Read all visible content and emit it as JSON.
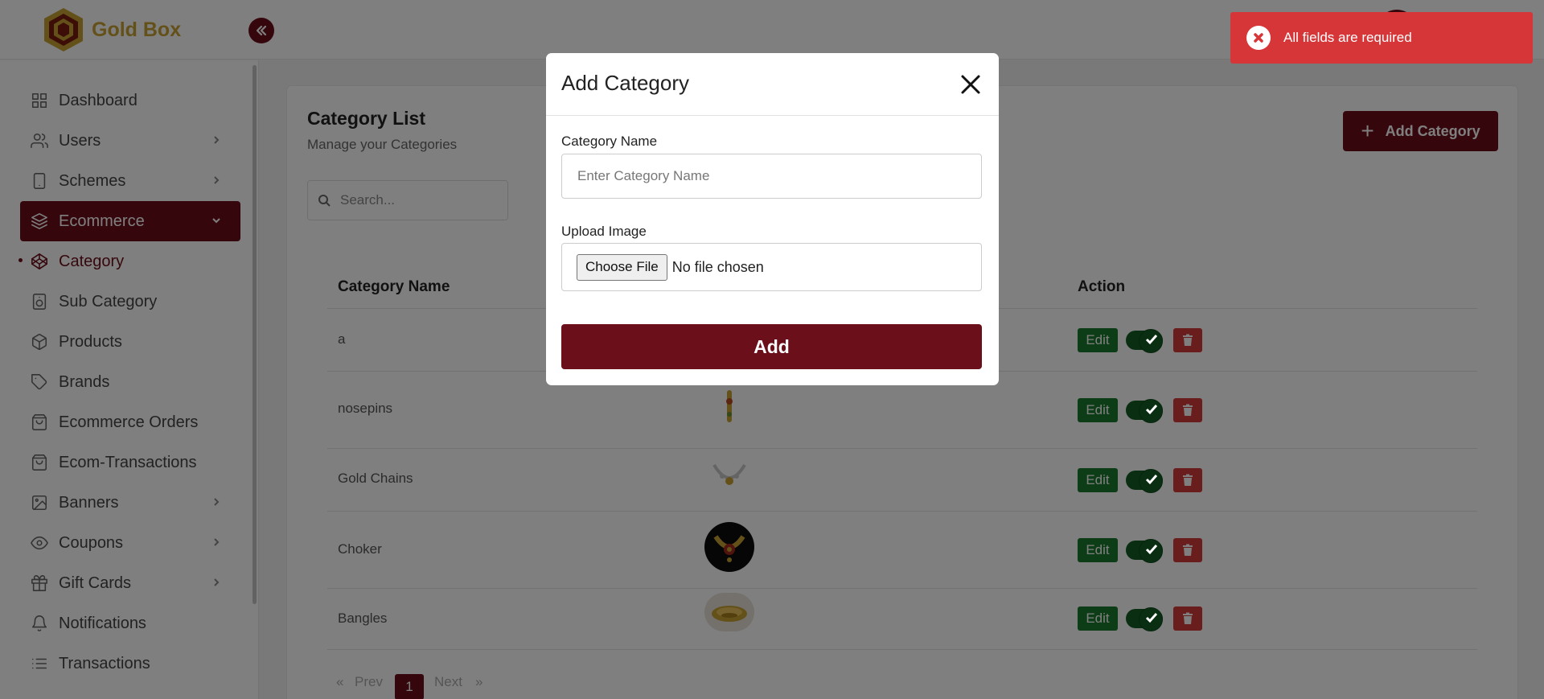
{
  "app": {
    "name": "Gold Box"
  },
  "colors": {
    "brand": "#6b0f1a",
    "gold": "#c9a234",
    "success": "#1b7a2c",
    "danger": "#d43a3a"
  },
  "sidebar": {
    "items": [
      {
        "label": "Dashboard",
        "icon": "grid-icon",
        "has_chevron": false
      },
      {
        "label": "Users",
        "icon": "users-icon",
        "has_chevron": true
      },
      {
        "label": "Schemes",
        "icon": "tablet-icon",
        "has_chevron": true
      },
      {
        "label": "Ecommerce",
        "icon": "layers-icon",
        "has_chevron": true,
        "active": true
      },
      {
        "label": "Category",
        "icon": "codepen-icon",
        "has_chevron": false,
        "sub_active": true
      },
      {
        "label": "Sub Category",
        "icon": "speaker-icon",
        "has_chevron": false
      },
      {
        "label": "Products",
        "icon": "box-icon",
        "has_chevron": false
      },
      {
        "label": "Brands",
        "icon": "tag-icon",
        "has_chevron": false
      },
      {
        "label": "Ecommerce Orders",
        "icon": "shopping-bag-icon",
        "has_chevron": false
      },
      {
        "label": "Ecom-Transactions",
        "icon": "shopping-bag-icon",
        "has_chevron": false
      },
      {
        "label": "Banners",
        "icon": "image-icon",
        "has_chevron": true
      },
      {
        "label": "Coupons",
        "icon": "eye-icon",
        "has_chevron": true
      },
      {
        "label": "Gift Cards",
        "icon": "gift-icon",
        "has_chevron": true
      },
      {
        "label": "Notifications",
        "icon": "bell-icon",
        "has_chevron": false
      },
      {
        "label": "Transactions",
        "icon": "list-icon",
        "has_chevron": false
      }
    ]
  },
  "main": {
    "title": "Category List",
    "subtitle": "Manage your Categories",
    "add_button": "Add Category",
    "search_placeholder": "Search...",
    "columns": [
      "Category Name",
      "Action"
    ],
    "rows": [
      {
        "name": "a"
      },
      {
        "name": "nosepins"
      },
      {
        "name": "Gold Chains"
      },
      {
        "name": "Choker"
      },
      {
        "name": "Bangles"
      }
    ],
    "edit_label": "Edit",
    "pager": {
      "prev": "Prev",
      "next": "Next",
      "current": "1",
      "first": "«",
      "last": "»"
    }
  },
  "modal": {
    "title": "Add Category",
    "name_label": "Category Name",
    "name_placeholder": "Enter Category Name",
    "image_label": "Upload Image",
    "file_button": "Choose File",
    "file_status": "No file chosen",
    "submit": "Add"
  },
  "toast": {
    "message": "All fields are required"
  }
}
